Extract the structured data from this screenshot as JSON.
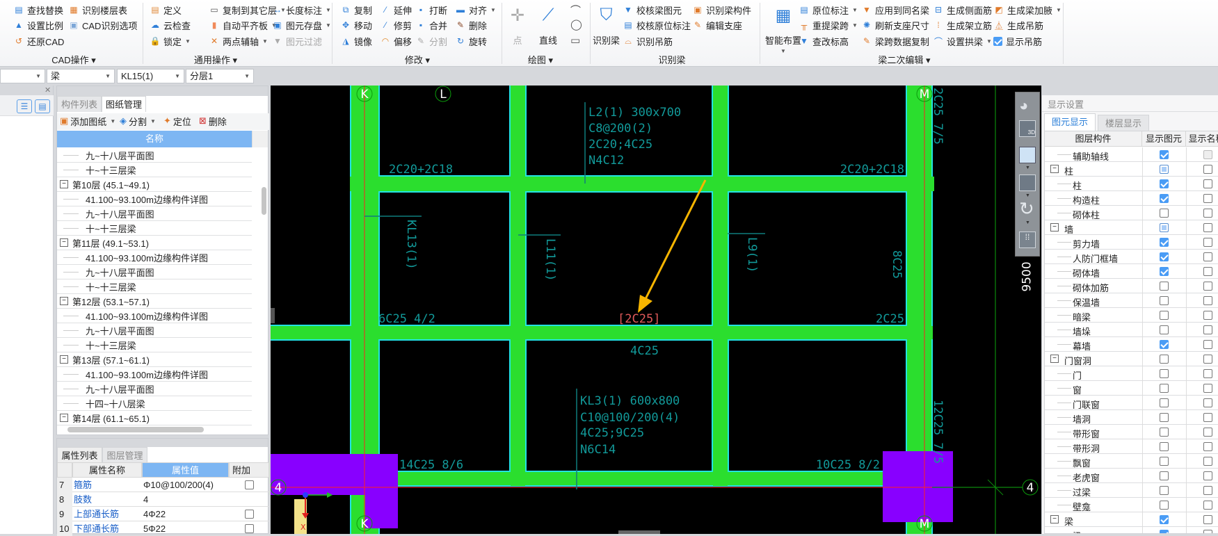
{
  "ribbon": {
    "groups": [
      {
        "label": "CAD操作 ▾",
        "items": [
          {
            "label": "查找替换",
            "icon": "find-replace-icon",
            "glyph": "▤",
            "color": "#2f7fd8"
          },
          {
            "label": "识别楼层表",
            "icon": "floor-table-icon",
            "glyph": "▦",
            "color": "#e07a2a"
          },
          {
            "label": "设置比例",
            "icon": "scale-icon",
            "glyph": "▲",
            "color": "#2f7fd8"
          },
          {
            "label": "CAD识别选项",
            "icon": "cad-options-icon",
            "glyph": "▣",
            "color": "#7da7d8"
          },
          {
            "label": "还原CAD",
            "icon": "restore-cad-icon",
            "glyph": "↺",
            "color": "#e07a2a"
          }
        ]
      },
      {
        "label": "通用操作 ▾",
        "items": [
          {
            "label": "定义",
            "icon": "define-icon",
            "glyph": "▤",
            "color": "#e08a3a"
          },
          {
            "label": "复制到其它层",
            "icon": "copy-to-floor-icon",
            "glyph": "▭",
            "color": "#555",
            "dropdown": true
          },
          {
            "label": "长度标注",
            "icon": "length-dimension-icon",
            "glyph": "↔",
            "color": "#2f7fd8",
            "dropdown": true
          },
          {
            "label": "云检查",
            "icon": "cloud-check-icon",
            "glyph": "☁",
            "color": "#2f7fd8"
          },
          {
            "label": "自动平齐板",
            "icon": "auto-align-slab-icon",
            "glyph": "▮",
            "color": "#f08a5a",
            "dropdown": true
          },
          {
            "label": "图元存盘",
            "icon": "save-element-icon",
            "glyph": "▣",
            "color": "#2f7fd8",
            "dropdown": true
          },
          {
            "label": "锁定",
            "icon": "lock-icon",
            "glyph": "🔒",
            "color": "#2f7fd8",
            "dropdown": true
          },
          {
            "label": "两点辅轴",
            "icon": "two-point-axis-icon",
            "glyph": "✕",
            "color": "#e07a2a",
            "dropdown": true
          },
          {
            "label": "图元过滤",
            "icon": "filter-icon",
            "glyph": "▼",
            "color": "#aaa",
            "disabled": true
          }
        ]
      },
      {
        "label": "修改 ▾",
        "items": [
          {
            "label": "复制",
            "icon": "copy-icon",
            "glyph": "⧉",
            "color": "#2f7fd8"
          },
          {
            "label": "延伸",
            "icon": "extend-icon",
            "glyph": "⁄",
            "color": "#2f7fd8"
          },
          {
            "label": "打断",
            "icon": "break-icon",
            "glyph": "▪",
            "color": "#2f7fd8"
          },
          {
            "label": "对齐",
            "icon": "align-icon",
            "glyph": "▬",
            "color": "#2f7fd8",
            "dropdown": true
          },
          {
            "label": "移动",
            "icon": "move-icon",
            "glyph": "✥",
            "color": "#2f7fd8"
          },
          {
            "label": "修剪",
            "icon": "trim-icon",
            "glyph": "⁄",
            "color": "#2f7fd8"
          },
          {
            "label": "合并",
            "icon": "merge-icon",
            "glyph": "▪",
            "color": "#2f7fd8"
          },
          {
            "label": "删除",
            "icon": "delete-icon",
            "glyph": "✎",
            "color": "#8a4a2a"
          },
          {
            "label": "镜像",
            "icon": "mirror-icon",
            "glyph": "◮",
            "color": "#2f7fd8"
          },
          {
            "label": "偏移",
            "icon": "offset-icon",
            "glyph": "◠",
            "color": "#e08a2a"
          },
          {
            "label": "分割",
            "icon": "split-icon",
            "glyph": "✎",
            "color": "#aaa",
            "disabled": true
          },
          {
            "label": "旋转",
            "icon": "rotate-icon",
            "glyph": "↻",
            "color": "#2f7fd8"
          }
        ]
      },
      {
        "label": "绘图 ▾",
        "large": [
          {
            "label": "点",
            "icon": "point-icon",
            "glyph": "✛",
            "color": "#aaa",
            "disabled": true
          },
          {
            "label": "直线",
            "icon": "line-icon",
            "glyph": "⟋",
            "color": "#2f7fd8"
          }
        ],
        "small": [
          {
            "icon": "arc-icon",
            "glyph": "⌒"
          },
          {
            "icon": "circle-icon",
            "glyph": "◯"
          },
          {
            "icon": "rectangle-icon",
            "glyph": "▭"
          }
        ]
      },
      {
        "label": "识别梁",
        "large": [
          {
            "label": "识别梁",
            "icon": "identify-beam-icon",
            "glyph": "⛉",
            "color": "#2f7fd8"
          }
        ],
        "items": [
          {
            "label": "校核梁图元",
            "icon": "check-beam-icon",
            "glyph": "▼",
            "color": "#2f7fd8"
          },
          {
            "label": "识别梁构件",
            "icon": "identify-beam-component-icon",
            "glyph": "▣",
            "color": "#e07a2a"
          },
          {
            "label": "校核原位标注",
            "icon": "check-annotation-icon",
            "glyph": "▤",
            "color": "#2f7fd8"
          },
          {
            "label": "编辑支座",
            "icon": "edit-support-icon",
            "glyph": "✎",
            "color": "#e07a2a"
          },
          {
            "label": "识别吊筋",
            "icon": "identify-hanger-icon",
            "glyph": "⌓",
            "color": "#e07a2a"
          }
        ]
      },
      {
        "label": "梁二次编辑 ▾",
        "large": [
          {
            "label": "智能布置",
            "icon": "smart-layout-icon",
            "glyph": "▦",
            "color": "#2f7fd8",
            "dropdown": true
          }
        ],
        "items": [
          {
            "label": "原位标注",
            "icon": "in-situ-annotation-icon",
            "glyph": "▤",
            "color": "#2f7fd8",
            "dropdown": true
          },
          {
            "label": "应用到同名梁",
            "icon": "apply-same-beam-icon",
            "glyph": "▼",
            "color": "#e07a2a"
          },
          {
            "label": "生成侧面筋",
            "icon": "side-rebar-icon",
            "glyph": "⊟",
            "color": "#2f7fd8"
          },
          {
            "label": "生成梁加腋",
            "icon": "beam-haunch-icon",
            "glyph": "◩",
            "color": "#e07a2a",
            "dropdown": true
          },
          {
            "label": "重提梁跨",
            "icon": "re-extract-span-icon",
            "glyph": "╥",
            "color": "#e07a2a",
            "dropdown": true
          },
          {
            "label": "刷新支座尺寸",
            "icon": "refresh-support-icon",
            "glyph": "✺",
            "color": "#2f7fd8"
          },
          {
            "label": "生成架立筋",
            "icon": "erection-rebar-icon",
            "glyph": "⁞",
            "color": "#e07a2a"
          },
          {
            "label": "生成吊筋",
            "icon": "hanger-rebar-icon",
            "glyph": "⏅",
            "color": "#e07a2a"
          },
          {
            "label": "查改标高",
            "icon": "elevation-icon",
            "glyph": "▼",
            "color": "#2f7fd8"
          },
          {
            "label": "梁跨数据复制",
            "icon": "span-copy-icon",
            "glyph": "✎",
            "color": "#e07a2a"
          },
          {
            "label": "设置拱梁",
            "icon": "arch-beam-icon",
            "glyph": "⌒",
            "color": "#2f7fd8",
            "dropdown": true
          },
          {
            "label": "显示吊筋",
            "icon": "checkbox-icon",
            "checkbox": true,
            "checked": true
          }
        ]
      }
    ]
  },
  "toolbar": {
    "combo0": "",
    "combo1": "梁",
    "combo2": "KL15(1)",
    "combo3": "分层1"
  },
  "drawing_panel": {
    "tabs": [
      "构件列表",
      "图纸管理"
    ],
    "actions": [
      "添加图纸",
      "分割",
      "定位",
      "删除"
    ],
    "column": "名称",
    "rows": [
      {
        "t": "九~十八层平面图",
        "g": false
      },
      {
        "t": "十~十三层梁",
        "g": false
      },
      {
        "t": "第10层 (45.1~49.1)",
        "g": true
      },
      {
        "t": "41.100~93.100m边缘构件详图",
        "g": false
      },
      {
        "t": "九~十八层平面图",
        "g": false
      },
      {
        "t": "十~十三层梁",
        "g": false
      },
      {
        "t": "第11层 (49.1~53.1)",
        "g": true
      },
      {
        "t": "41.100~93.100m边缘构件详图",
        "g": false
      },
      {
        "t": "九~十八层平面图",
        "g": false
      },
      {
        "t": "十~十三层梁",
        "g": false
      },
      {
        "t": "第12层 (53.1~57.1)",
        "g": true
      },
      {
        "t": "41.100~93.100m边缘构件详图",
        "g": false
      },
      {
        "t": "九~十八层平面图",
        "g": false
      },
      {
        "t": "十~十三层梁",
        "g": false
      },
      {
        "t": "第13层 (57.1~61.1)",
        "g": true
      },
      {
        "t": "41.100~93.100m边缘构件详图",
        "g": false
      },
      {
        "t": "九~十八层平面图",
        "g": false
      },
      {
        "t": "十四~十八层梁",
        "g": false
      },
      {
        "t": "第14层 (61.1~65.1)",
        "g": true
      }
    ]
  },
  "properties": {
    "tabs": [
      "属性列表",
      "图层管理"
    ],
    "columns": [
      "属性名称",
      "属性值",
      "附加"
    ],
    "rows": [
      {
        "n": "7",
        "name": "箍筋",
        "value": "Φ10@100/200(4)",
        "extra": true
      },
      {
        "n": "8",
        "name": "肢数",
        "value": "4",
        "extra": false
      },
      {
        "n": "9",
        "name": "上部通长筋",
        "value": "4Φ22",
        "extra": true
      },
      {
        "n": "10",
        "name": "下部通长筋",
        "value": "5Φ22",
        "extra": true
      }
    ]
  },
  "canvas": {
    "axes": {
      "k": "K",
      "l": "L",
      "m": "M",
      "four": "4"
    },
    "labels": {
      "l2_1": "L2(1) 300x700",
      "l2_2": "C8@200(2)",
      "l2_3": "2C20;4C25",
      "l2_4": "N4C12",
      "top_left": "2C20+2C18",
      "top_right": "2C20+2C18",
      "kl13": "KL13(1)",
      "l11": "L11(1)",
      "l9": "L9(1)",
      "c8c25": "8C25",
      "mid_left": "6C25 4/2",
      "mid_sel": "[2C25]",
      "mid_right": "2C25",
      "mid_below": "4C25",
      "kl3_1": "KL3(1) 600x800",
      "kl3_2": "C10@100/200(4)",
      "kl3_3": "4C25;9C25",
      "kl3_4": "N6C14",
      "bot_left": "14C25 8/6",
      "bot_right": "10C25 8/2",
      "m_top": "2C25 7/5",
      "m_bot": "12C25 7/5"
    },
    "dimension": "9500",
    "colors": {
      "beam": "#2bde2e",
      "outline": "#22e3e3",
      "column": "#8800ff",
      "axis": "#ff2020",
      "text": "#129a9a",
      "selected": "#e05a5a",
      "arrow": "#f7b500"
    }
  },
  "display_settings": {
    "title": "显示设置",
    "tabs": [
      "图元显示",
      "楼层显示"
    ],
    "columns": [
      "图层构件",
      "显示图元",
      "显示名称"
    ],
    "rows": [
      {
        "t": "辅助轴线",
        "g": false,
        "s": "on",
        "n": "dis"
      },
      {
        "t": "柱",
        "g": true,
        "s": "part",
        "n": "off"
      },
      {
        "t": "柱",
        "g": false,
        "s": "on",
        "n": "off"
      },
      {
        "t": "构造柱",
        "g": false,
        "s": "on",
        "n": "off"
      },
      {
        "t": "砌体柱",
        "g": false,
        "s": "off",
        "n": "off"
      },
      {
        "t": "墙",
        "g": true,
        "s": "part",
        "n": "off"
      },
      {
        "t": "剪力墙",
        "g": false,
        "s": "on",
        "n": "off"
      },
      {
        "t": "人防门框墙",
        "g": false,
        "s": "on",
        "n": "off"
      },
      {
        "t": "砌体墙",
        "g": false,
        "s": "on",
        "n": "off"
      },
      {
        "t": "砌体加筋",
        "g": false,
        "s": "off",
        "n": "off"
      },
      {
        "t": "保温墙",
        "g": false,
        "s": "off",
        "n": "off"
      },
      {
        "t": "暗梁",
        "g": false,
        "s": "off",
        "n": "off"
      },
      {
        "t": "墙垛",
        "g": false,
        "s": "off",
        "n": "off"
      },
      {
        "t": "幕墙",
        "g": false,
        "s": "on",
        "n": "off"
      },
      {
        "t": "门窗洞",
        "g": true,
        "s": "off",
        "n": "off"
      },
      {
        "t": "门",
        "g": false,
        "s": "off",
        "n": "off"
      },
      {
        "t": "窗",
        "g": false,
        "s": "off",
        "n": "off"
      },
      {
        "t": "门联窗",
        "g": false,
        "s": "off",
        "n": "off"
      },
      {
        "t": "墙洞",
        "g": false,
        "s": "off",
        "n": "off"
      },
      {
        "t": "带形窗",
        "g": false,
        "s": "off",
        "n": "off"
      },
      {
        "t": "带形洞",
        "g": false,
        "s": "off",
        "n": "off"
      },
      {
        "t": "飘窗",
        "g": false,
        "s": "off",
        "n": "off"
      },
      {
        "t": "老虎窗",
        "g": false,
        "s": "off",
        "n": "off"
      },
      {
        "t": "过梁",
        "g": false,
        "s": "off",
        "n": "off"
      },
      {
        "t": "壁龛",
        "g": false,
        "s": "off",
        "n": "off"
      },
      {
        "t": "梁",
        "g": true,
        "s": "on",
        "n": "off"
      },
      {
        "t": "梁",
        "g": false,
        "s": "on",
        "n": "off"
      }
    ]
  }
}
